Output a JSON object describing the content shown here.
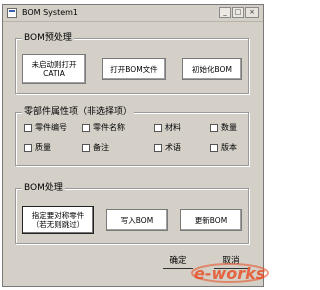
{
  "window": {
    "title": "BOM System1",
    "minimize_glyph": "_",
    "restore_glyph": "□",
    "close_glyph": "×"
  },
  "bom_preprocess": {
    "label": "BOM预处理",
    "buttons": {
      "start_catia": "未启动则打开CATIA",
      "open_bom": "打开BOM文件",
      "init_bom": "初始化BOM"
    }
  },
  "part_attributes": {
    "label": "零部件属性项（非选择项）",
    "items": [
      "零件编号",
      "零件名称",
      "材料",
      "数量",
      "质量",
      "备注",
      "术语",
      "版本"
    ]
  },
  "bom_process": {
    "label": "BOM处理",
    "buttons": {
      "specify_parts": "指定要对称零件（若无则跳过）",
      "write_bom": "写入BOM",
      "update_bom": "更新BOM"
    }
  },
  "dialog": {
    "ok": "确定",
    "cancel": "取消"
  },
  "watermark": {
    "text": "e-works",
    "color_accent": "#e84a1f"
  }
}
